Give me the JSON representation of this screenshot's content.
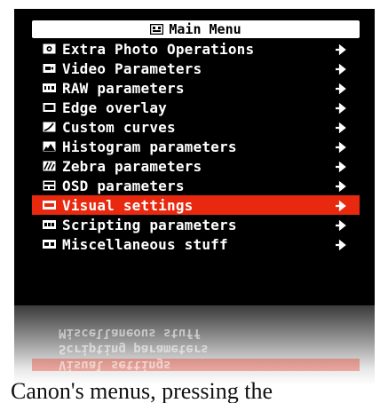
{
  "menu": {
    "title": "Main Menu",
    "title_icon": "camera-icon",
    "items": [
      {
        "label": "Extra Photo Operations",
        "icon": "camera-frame-icon"
      },
      {
        "label": "Video Parameters",
        "icon": "video-icon"
      },
      {
        "label": "RAW parameters",
        "icon": "raw-icon"
      },
      {
        "label": "Edge overlay",
        "icon": "edge-icon"
      },
      {
        "label": "Custom curves",
        "icon": "curve-icon"
      },
      {
        "label": "Histogram parameters",
        "icon": "histogram-icon"
      },
      {
        "label": "Zebra parameters",
        "icon": "zebra-icon"
      },
      {
        "label": "OSD parameters",
        "icon": "osd-icon"
      },
      {
        "label": "Visual settings",
        "icon": "disp-icon",
        "selected": true
      },
      {
        "label": "Scripting parameters",
        "icon": "script-icon"
      },
      {
        "label": "Miscellaneous stuff",
        "icon": "misc-icon"
      }
    ]
  },
  "reflection": {
    "rows": [
      "Miscellaneous stuff",
      "Scripting parameters",
      "Visual settings"
    ]
  },
  "caption": "Canon's menus, pressing the",
  "colors": {
    "selection": "#e8290f",
    "screen_bg": "#000000",
    "text": "#ffffff"
  }
}
